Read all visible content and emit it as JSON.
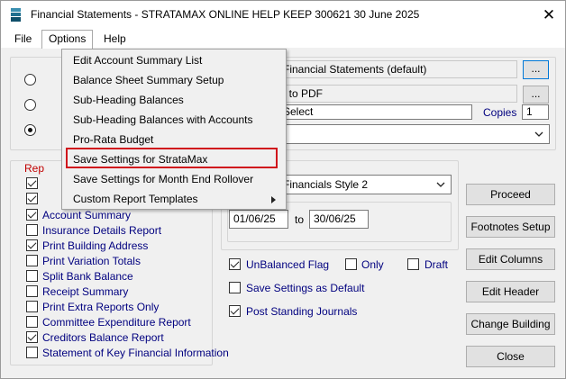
{
  "window": {
    "title": "Financial Statements - STRATAMAX ONLINE HELP KEEP 300621 30 June 2025",
    "close_glyph": "✕"
  },
  "menubar": {
    "items": [
      {
        "label": "File"
      },
      {
        "label": "Options"
      },
      {
        "label": "Help"
      }
    ]
  },
  "options_menu": {
    "items": [
      {
        "label": "Edit Account Summary List"
      },
      {
        "label": "Balance Sheet Summary Setup"
      },
      {
        "label": "Sub-Heading Balances"
      },
      {
        "label": "Sub-Heading Balances with Accounts"
      },
      {
        "label": "Pro-Rata Budget"
      },
      {
        "label": "Save Settings for StrataMax",
        "highlighted": true
      },
      {
        "label": "Save Settings for Month End Rollover"
      },
      {
        "label": "Custom Report Templates",
        "has_submenu": true
      }
    ]
  },
  "output": {
    "template_value": "Financial Statements (default)",
    "browse1_label": "...",
    "pdf_value": "t to PDF",
    "browse2_label": "...",
    "printer_value": "Select",
    "copies_label": "Copies",
    "copies_value": "1"
  },
  "reports": {
    "group_label": "Rep",
    "style_value": "Financials Style 2",
    "items": [
      {
        "label": "",
        "checked": true
      },
      {
        "label": "",
        "checked": true
      },
      {
        "label": "Account Summary",
        "checked": true
      },
      {
        "label": "Insurance Details Report",
        "checked": false
      },
      {
        "label": "Print Building Address",
        "checked": true
      },
      {
        "label": "Print Variation Totals",
        "checked": false
      },
      {
        "label": "Split Bank Balance",
        "checked": false
      },
      {
        "label": "Receipt Summary",
        "checked": false
      },
      {
        "label": "Print Extra Reports Only",
        "checked": false
      },
      {
        "label": "Committee Expenditure Report",
        "checked": false
      },
      {
        "label": "Creditors Balance Report",
        "checked": true
      },
      {
        "label": "Statement of Key Financial Information",
        "checked": false
      }
    ]
  },
  "dates": {
    "from": "01/06/25",
    "to_label": "to",
    "to": "30/06/25"
  },
  "options": {
    "unbalanced_flag": {
      "label": "UnBalanced Flag",
      "checked": true
    },
    "only": {
      "label": "Only",
      "checked": false
    },
    "draft": {
      "label": "Draft",
      "checked": false
    },
    "save_default": {
      "label": "Save Settings as Default",
      "checked": false
    },
    "post_standing": {
      "label": "Post Standing Journals",
      "checked": true
    }
  },
  "buttons": {
    "proceed": "Proceed",
    "footnotes": "Footnotes Setup",
    "edit_columns": "Edit Columns",
    "edit_header": "Edit Header",
    "change_building": "Change Building",
    "close": "Close"
  },
  "colors": {
    "label_navy": "#00007f",
    "highlight_red": "#d0141c",
    "focus_blue": "#0078d7"
  }
}
